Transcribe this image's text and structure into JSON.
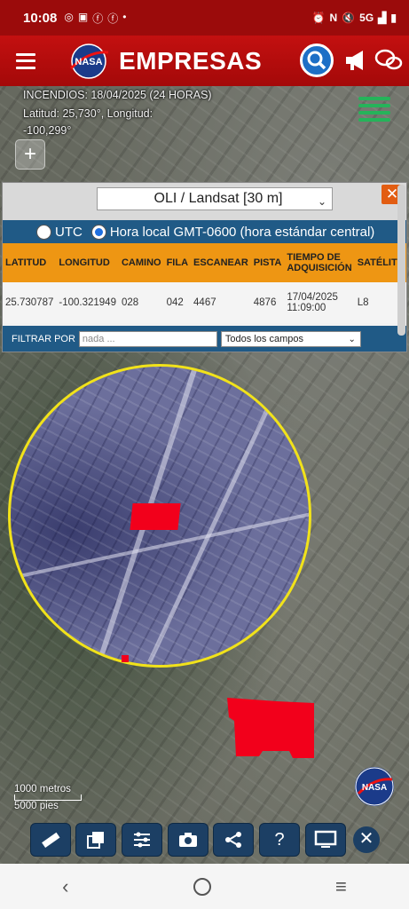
{
  "status_bar": {
    "time": "10:08",
    "left_icons": [
      "whatsapp-icon",
      "voicemail-icon",
      "facebook-icon",
      "facebook-icon",
      "dot-icon"
    ],
    "network": "5G",
    "right_icons": [
      "alarm-icon",
      "nfc-icon",
      "volume-off-icon",
      "wifi-icon",
      "signal-icon",
      "battery-icon"
    ]
  },
  "app_bar": {
    "title": "EMPRESAS",
    "logo_text": "NASA"
  },
  "map": {
    "layer_text": "INCENDIOS: 18/04/2025 (24 HORAS)",
    "coords_text": "Latitud: 25,730°, Longitud:",
    "coords_text_2": "-100,299°",
    "zoom_in": "+",
    "scale_m": "1000 metros",
    "scale_ft": "5000 pies",
    "badge_text": "NASA"
  },
  "panel": {
    "sensor": "OLI / Landsat [30 m]",
    "close": "✕",
    "tz_utc": "UTC",
    "tz_local": "Hora local GMT-0600 (hora estándar central)",
    "tz_selected": "local",
    "columns": [
      "LATITUD",
      "LONGITUD",
      "CAMINO",
      "FILA",
      "ESCANEAR",
      "PISTA",
      "TIEMPO DE ADQUISICIÓN",
      "SATÉLITE"
    ],
    "rows": [
      [
        "25.730787",
        "-100.321949",
        "028",
        "042",
        "4467",
        "4876",
        "17/04/2025 11:09:00",
        "L8"
      ]
    ],
    "filter_label": "FILTRAR POR",
    "filter_placeholder": "nada ...",
    "filter_field": "Todos los campos"
  },
  "toolbar": {
    "items": [
      "ruler-icon",
      "copy-icon",
      "sliders-icon",
      "camera-icon",
      "share-icon",
      "help-icon",
      "monitor-icon",
      "close-icon"
    ],
    "help": "?",
    "close": "✕"
  },
  "nav": {
    "back": "‹",
    "menu": "≡"
  },
  "colors": {
    "brand_red": "#b30d0d",
    "panel_blue": "#205a86",
    "header_orange": "#ee9613",
    "fire_red": "#f2001b",
    "magnifier_ring": "#f1e21a"
  }
}
